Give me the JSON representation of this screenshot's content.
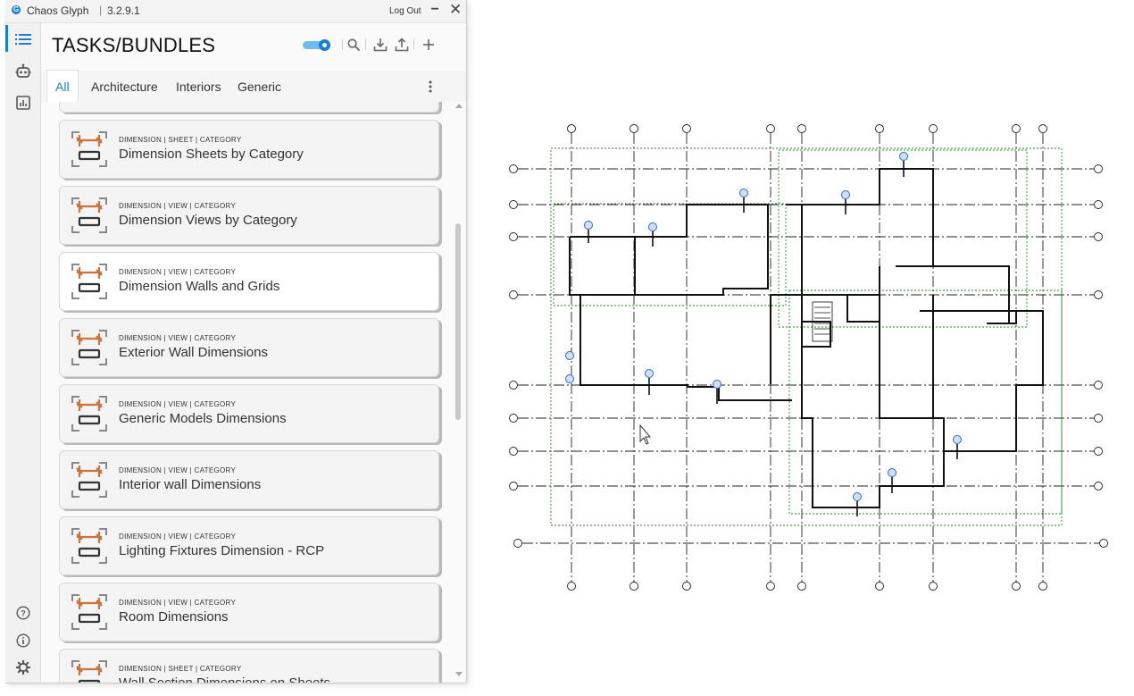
{
  "window": {
    "app_name": "Chaos Glyph",
    "separator": "|",
    "version": "3.2.9.1",
    "logout_label": "Log Out",
    "minimize_label": "−",
    "close_label": "✕"
  },
  "siderail": {
    "items": [
      {
        "icon": "list-icon",
        "active": true
      },
      {
        "icon": "robot-icon",
        "active": false
      },
      {
        "icon": "chart-icon",
        "active": false
      }
    ],
    "bottom": [
      {
        "icon": "help-icon"
      },
      {
        "icon": "info-icon"
      },
      {
        "icon": "gear-icon"
      }
    ]
  },
  "header": {
    "title": "TASKS/BUNDLES",
    "toggle_on": true,
    "tools": [
      "search-icon",
      "download-icon",
      "upload-icon",
      "plus-icon"
    ]
  },
  "tabs": [
    {
      "label": "All",
      "active": true
    },
    {
      "label": "Architecture",
      "active": false
    },
    {
      "label": "Interiors",
      "active": false
    },
    {
      "label": "Generic",
      "active": false
    }
  ],
  "cards": [
    {
      "meta": "DIMENSION | SHEET | CATEGORY",
      "title": "Dimension Sheets by Category",
      "selected": false
    },
    {
      "meta": "DIMENSION | VIEW | CATEGORY",
      "title": "Dimension Views by Category",
      "selected": false
    },
    {
      "meta": "DIMENSION | VIEW | CATEGORY",
      "title": "Dimension Walls and Grids",
      "selected": true
    },
    {
      "meta": "DIMENSION | VIEW | CATEGORY",
      "title": "Exterior Wall Dimensions",
      "selected": false
    },
    {
      "meta": "DIMENSION | VIEW | CATEGORY",
      "title": "Generic Models Dimensions",
      "selected": false
    },
    {
      "meta": "DIMENSION | VIEW | CATEGORY",
      "title": "Interior wall Dimensions",
      "selected": false
    },
    {
      "meta": "DIMENSION | VIEW | CATEGORY",
      "title": "Lighting Fixtures Dimension - RCP",
      "selected": false
    },
    {
      "meta": "DIMENSION | VIEW | CATEGORY",
      "title": "Room Dimensions",
      "selected": false
    },
    {
      "meta": "DIMENSION | SHEET | CATEGORY",
      "title": "Wall Section Dimensions on Sheets",
      "selected": false
    }
  ],
  "colors": {
    "accent": "#1a7fd4",
    "icon_orange": "#c9733e",
    "plan_walls": "#111111",
    "plan_grid": "#222222",
    "plan_crop": "#1e8a1e",
    "plan_markers": "#2b6cd0"
  },
  "scroll": {
    "thumb_fraction": 0.34,
    "position_fraction": 0.21
  },
  "canvas": {
    "cursor_icon": "mouse-pointer-icon"
  }
}
